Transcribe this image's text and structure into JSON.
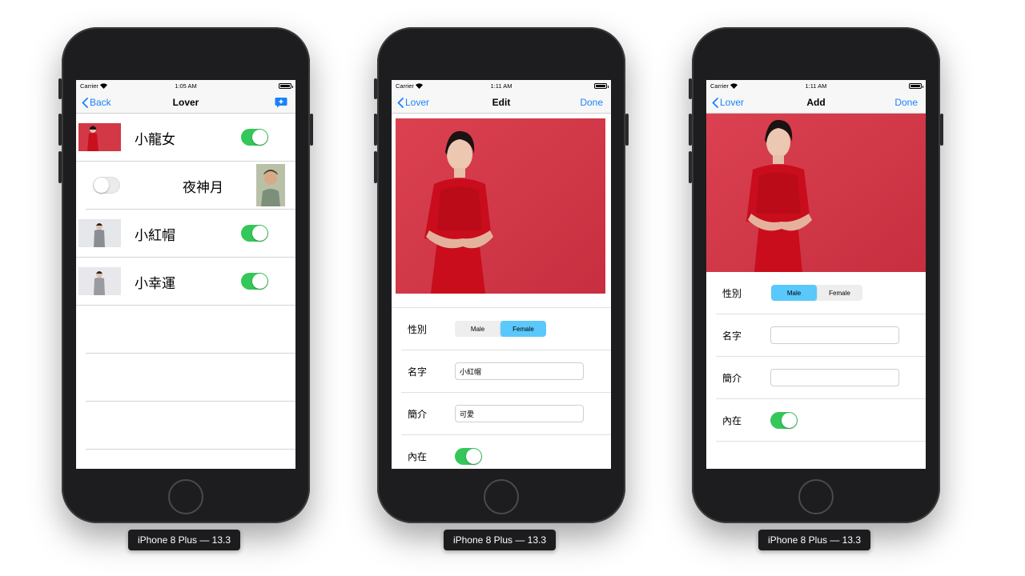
{
  "status_bar": {
    "carrier": "Carrier"
  },
  "battery_level": 1.0,
  "devices": [
    {
      "label": "iPhone 8 Plus — 13.3",
      "time": "1:05 AM",
      "nav": {
        "back": "Back",
        "title": "Lover",
        "right_icon": "compose-icon"
      },
      "rows": [
        {
          "name": "小龍女",
          "on": true
        },
        {
          "name": "夜神月",
          "on": false
        },
        {
          "name": "小紅帽",
          "on": true
        },
        {
          "name": "小幸運",
          "on": true
        }
      ]
    },
    {
      "label": "iPhone 8 Plus — 13.3",
      "time": "1:11 AM",
      "nav": {
        "back": "Lover",
        "title": "Edit",
        "right": "Done"
      },
      "form": {
        "gender_label": "性別",
        "gender_options": [
          "Male",
          "Female"
        ],
        "gender_selected": "Female",
        "name_label": "名字",
        "name_value": "小紅帽",
        "intro_label": "簡介",
        "intro_value": "可愛",
        "inner_label": "內在",
        "inner_on": true
      }
    },
    {
      "label": "iPhone 8 Plus — 13.3",
      "time": "1:11 AM",
      "nav": {
        "back": "Lover",
        "title": "Add",
        "right": "Done"
      },
      "form": {
        "gender_label": "性別",
        "gender_options": [
          "Male",
          "Female"
        ],
        "gender_selected": "Male",
        "name_label": "名字",
        "name_value": "",
        "intro_label": "簡介",
        "intro_value": "",
        "inner_label": "內在",
        "inner_on": true
      }
    }
  ],
  "colors": {
    "accent": "#1a82fb",
    "toggle_on": "#34c759",
    "segment_selected": "#5ac8fa",
    "photo_bg": "#d23846"
  }
}
